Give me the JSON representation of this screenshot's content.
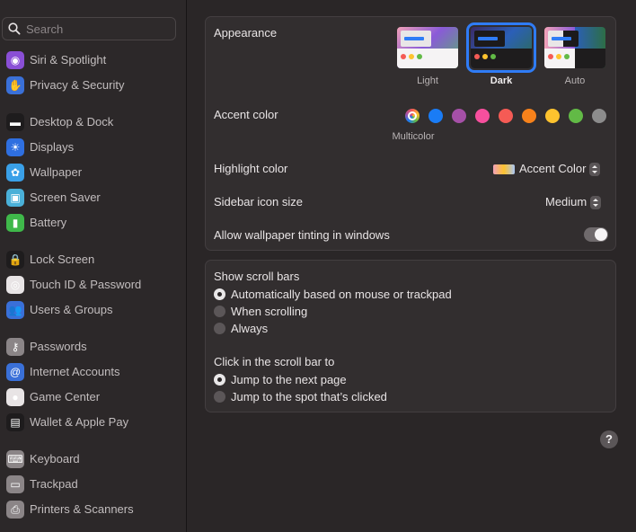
{
  "sidebar": {
    "search_placeholder": "Search",
    "items": [
      {
        "label": "Siri & Spotlight",
        "icon": "siri-icon",
        "color": "#8a4fd6",
        "glyph": "◉"
      },
      {
        "label": "Privacy & Security",
        "icon": "hand-icon",
        "color": "#3a70d8",
        "glyph": "✋"
      },
      {
        "label": "Desktop & Dock",
        "icon": "dock-icon",
        "color": "#1e1c1d",
        "glyph": "▬"
      },
      {
        "label": "Displays",
        "icon": "sun-icon",
        "color": "#2f6fe0",
        "glyph": "☀"
      },
      {
        "label": "Wallpaper",
        "icon": "flower-icon",
        "color": "#3aa0e8",
        "glyph": "✿"
      },
      {
        "label": "Screen Saver",
        "icon": "screensaver-icon",
        "color": "#4ab0d8",
        "glyph": "▣"
      },
      {
        "label": "Battery",
        "icon": "battery-icon",
        "color": "#3fb84a",
        "glyph": "▮"
      },
      {
        "label": "Lock Screen",
        "icon": "lock-icon",
        "color": "#1e1c1d",
        "glyph": "🔒"
      },
      {
        "label": "Touch ID & Password",
        "icon": "fingerprint-icon",
        "color": "#e8e4e5",
        "glyph": "◎"
      },
      {
        "label": "Users & Groups",
        "icon": "users-icon",
        "color": "#3a70d8",
        "glyph": "👥"
      },
      {
        "label": "Passwords",
        "icon": "key-icon",
        "color": "#8b8587",
        "glyph": "⚷"
      },
      {
        "label": "Internet Accounts",
        "icon": "at-icon",
        "color": "#3a70d8",
        "glyph": "@"
      },
      {
        "label": "Game Center",
        "icon": "gamecenter-icon",
        "color": "#e8e4e5",
        "glyph": "●"
      },
      {
        "label": "Wallet & Apple Pay",
        "icon": "wallet-icon",
        "color": "#1e1c1d",
        "glyph": "▤"
      },
      {
        "label": "Keyboard",
        "icon": "keyboard-icon",
        "color": "#8b8587",
        "glyph": "⌨"
      },
      {
        "label": "Trackpad",
        "icon": "trackpad-icon",
        "color": "#8b8587",
        "glyph": "▭"
      },
      {
        "label": "Printers & Scanners",
        "icon": "printer-icon",
        "color": "#8b8587",
        "glyph": "⎙"
      }
    ]
  },
  "appearance": {
    "label": "Appearance",
    "options": [
      {
        "label": "Light",
        "selected": false
      },
      {
        "label": "Dark",
        "selected": true
      },
      {
        "label": "Auto",
        "selected": false
      }
    ]
  },
  "accent": {
    "label": "Accent color",
    "selected_caption": "Multicolor",
    "colors": [
      "multicolor",
      "#1a7cf5",
      "#a550a7",
      "#f74f9e",
      "#f55b55",
      "#f7821b",
      "#fec32e",
      "#62ba46",
      "#8c8c8c"
    ]
  },
  "highlight": {
    "label": "Highlight color",
    "value": "Accent Color"
  },
  "sidebar_icon_size": {
    "label": "Sidebar icon size",
    "value": "Medium"
  },
  "wallpaper_tinting": {
    "label": "Allow wallpaper tinting in windows",
    "on": true
  },
  "scroll_bars": {
    "label": "Show scroll bars",
    "options": [
      {
        "label": "Automatically based on mouse or trackpad",
        "selected": true
      },
      {
        "label": "When scrolling",
        "selected": false
      },
      {
        "label": "Always",
        "selected": false
      }
    ]
  },
  "click_scroll": {
    "label": "Click in the scroll bar to",
    "options": [
      {
        "label": "Jump to the next page",
        "selected": true
      },
      {
        "label": "Jump to the spot that’s clicked",
        "selected": false
      }
    ]
  },
  "help": "?"
}
